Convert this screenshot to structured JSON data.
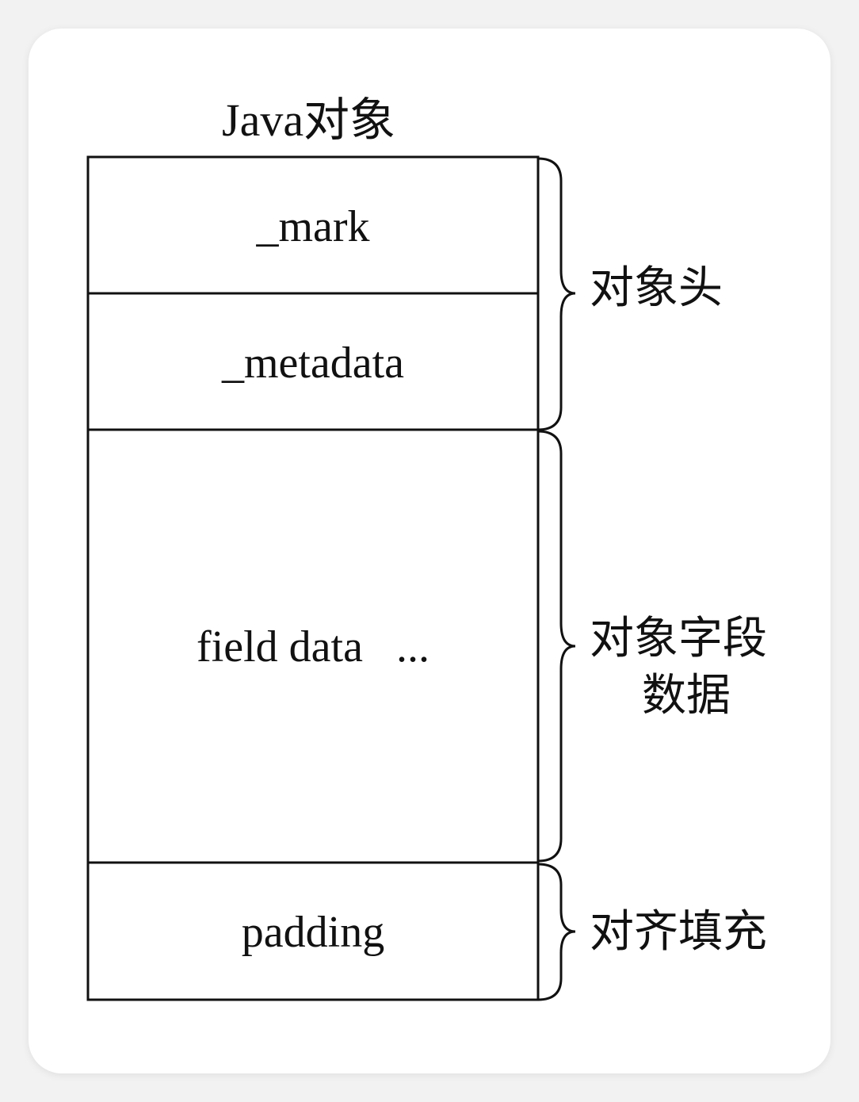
{
  "title": "Java对象",
  "segments": [
    {
      "label": "_mark"
    },
    {
      "label": "_metadata"
    },
    {
      "label": "field data   ..."
    },
    {
      "label": "padding"
    }
  ],
  "braces": [
    {
      "label": "对象头"
    },
    {
      "label_line1": "对象字段",
      "label_line2": "数据"
    },
    {
      "label": "对齐填充"
    }
  ]
}
